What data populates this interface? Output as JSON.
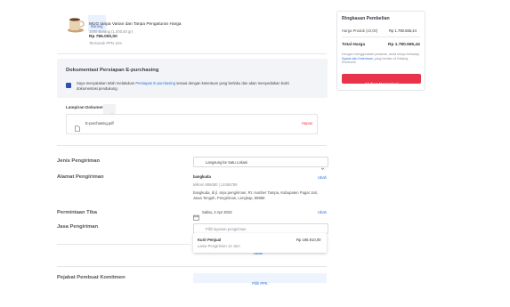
{
  "product": {
    "badge": "Barang",
    "name": "MUG tanpa Varian dan Tanpa Pengaturan Harga",
    "qty": "1000 Barang (1.000,00 gr)",
    "price": "Rp 786.000,00",
    "tax": "Termasuk PPN 11%"
  },
  "epurchasing": {
    "title": "Dokumentasi Persiapan E-purchasing",
    "agree_prefix": "Saya menyatakan telah melakukan",
    "agree_link": "Persiapan E-purchasing",
    "agree_suffix": "sesuai dengan ketentuan yang berlaku dan akan menyediakan bukti dokumentasi pendukung."
  },
  "attachment": {
    "label": "Lampiran Dokumen",
    "tag": "Wajib",
    "filename": "E-purchasing.pdf",
    "delete": "Hapus"
  },
  "form": {
    "shipping_type_label": "Jenis Pengiriman",
    "shipping_type_value": "Langsung ke Satu Lokasi",
    "address_label": "Alamat Pengiriman",
    "address_name": "bangkuda",
    "address_phone": "telkom 808080 | 12456789",
    "address_detail": "bangkuda, di jl. arya pengiriman, Rt. number Tampa, Kabupaten Pagar Jati, Jawa Tengah, Pengiriman, Lengkap, 89888",
    "address_change": "Ubah",
    "arrival_label": "Permintaan Tiba",
    "arrival_value": "Sabtu, 2 Apr 2023",
    "arrival_change": "Ubah",
    "service_label": "Jasa Pengiriman",
    "service_placeholder": "Pilih layanan pengiriman",
    "official_label": "Pejabat Pembuat Komitmen",
    "official_button": "Pilih PPK"
  },
  "dropdown": {
    "option_name": "Kurir Penjual",
    "option_sub": "Lama Pengiriman 14 Jam",
    "option_price": "Rp 186.910,00",
    "hidden_link": "Ubah"
  },
  "summary": {
    "title": "Ringkasan Pembelian",
    "subtotal_label": "Harga Produk (10,00)",
    "subtotal_value": "Rp 1.780.555,44",
    "total_label": "Total Harga",
    "total_value": "Rp 1.780.555,44",
    "note_prefix": "Dengan menggunakan pesanan, anda setuju terhadap",
    "note_link": "Syarat dan Ketentuan,",
    "note_suffix": "yang berlaku di Katalog Elektronik.",
    "button": "Ajukan Negosiasi"
  },
  "colors": {
    "accent": "#2f6fd6",
    "danger": "#e8334a",
    "checkbox": "#2f4fb6"
  }
}
